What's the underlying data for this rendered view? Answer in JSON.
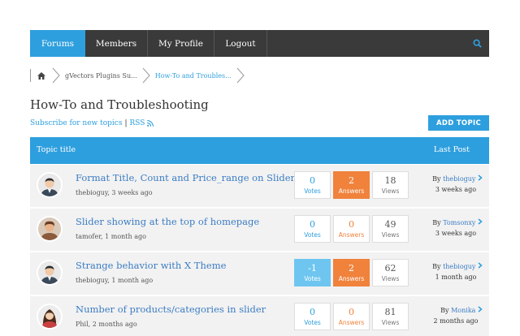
{
  "nav": {
    "items": [
      {
        "label": "Forums",
        "active": true
      },
      {
        "label": "Members",
        "active": false
      },
      {
        "label": "My Profile",
        "active": false
      },
      {
        "label": "Logout",
        "active": false
      }
    ],
    "search_icon": "search-icon"
  },
  "breadcrumb": {
    "home_icon": "home-icon",
    "items": [
      {
        "label": "gVectors Plugins Su..."
      },
      {
        "label": "How-To and Troubles..."
      }
    ]
  },
  "page": {
    "title": "How-To and Troubleshooting",
    "subscribe_label": "Subscribe for new topics",
    "separator": "|",
    "rss_label": "RSS",
    "add_topic_label": "ADD TOPIC"
  },
  "table": {
    "header_title": "Topic title",
    "header_last": "Last Post",
    "votes_label": "Votes",
    "answers_label": "Answers",
    "views_label": "Views",
    "by_label": "By",
    "rows": [
      {
        "title": "Format Title, Count and Price_range on Slider?",
        "meta": "thebioguy, 3 weeks ago",
        "votes": "0",
        "answers": "2",
        "views": "18",
        "last_user": "thebioguy",
        "last_time": "3 weeks ago"
      },
      {
        "title": "Slider showing at the top of homepage",
        "meta": "tamofer, 1 month ago",
        "votes": "0",
        "answers": "0",
        "views": "49",
        "last_user": "Tomsonxy",
        "last_time": "3 weeks ago"
      },
      {
        "title": "Strange behavior with X Theme",
        "meta": "thebioguy, 1 month ago",
        "votes": "-1",
        "answers": "2",
        "views": "62",
        "last_user": "thebioguy",
        "last_time": "1 month ago"
      },
      {
        "title": "Number of products/categories in slider",
        "meta": "Phil, 2 months ago",
        "votes": "0",
        "answers": "0",
        "views": "81",
        "last_user": "Monika",
        "last_time": "2 months ago"
      }
    ]
  },
  "colors": {
    "accent": "#2e9fde",
    "orange": "#f0823c",
    "nav": "#3a3a3a"
  }
}
